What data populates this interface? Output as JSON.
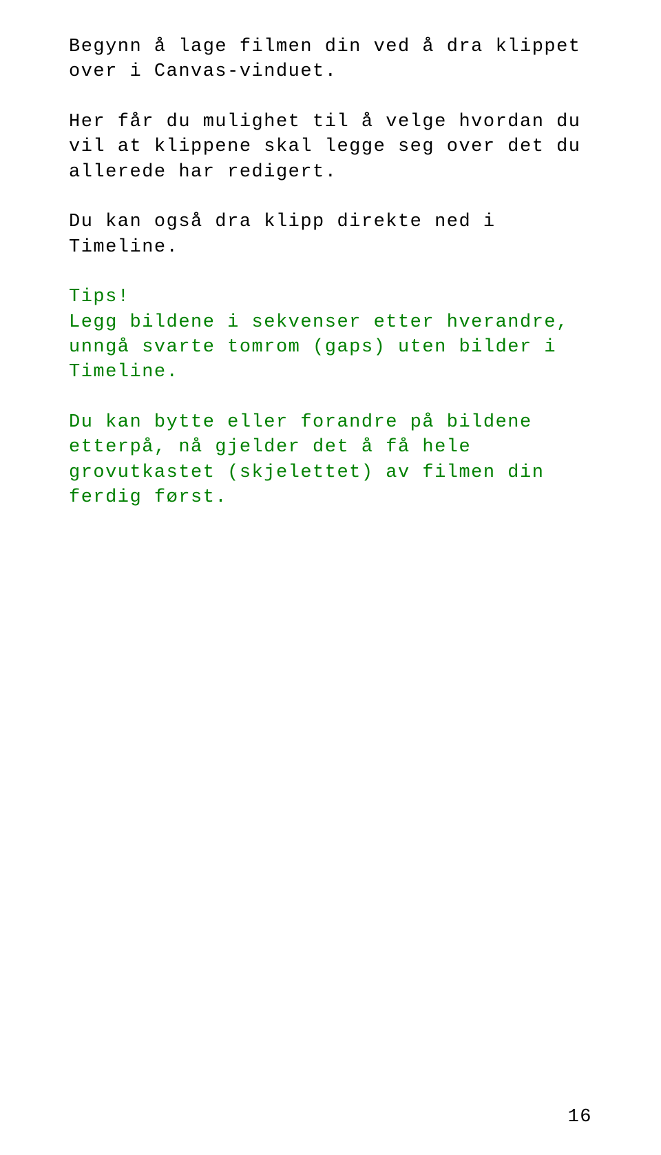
{
  "paragraphs": [
    {
      "color": "black",
      "text": "Begynn å lage filmen din ved å dra klippet over i Canvas-vinduet."
    },
    {
      "color": "black",
      "text": "Her får du mulighet til å velge hvordan du vil at klippene skal legge seg over det du allerede har redigert."
    },
    {
      "color": "black",
      "text": "Du kan også dra klipp direkte ned i Timeline."
    },
    {
      "color": "green",
      "text": "Tips!\nLegg bildene i sekvenser etter hverandre, unngå svarte tomrom (gaps) uten bilder i Timeline."
    },
    {
      "color": "green",
      "text": "Du kan bytte eller forandre på bildene etterpå, nå gjelder det å få hele grovutkastet (skjelettet) av filmen din ferdig først."
    }
  ],
  "page_number": "16"
}
